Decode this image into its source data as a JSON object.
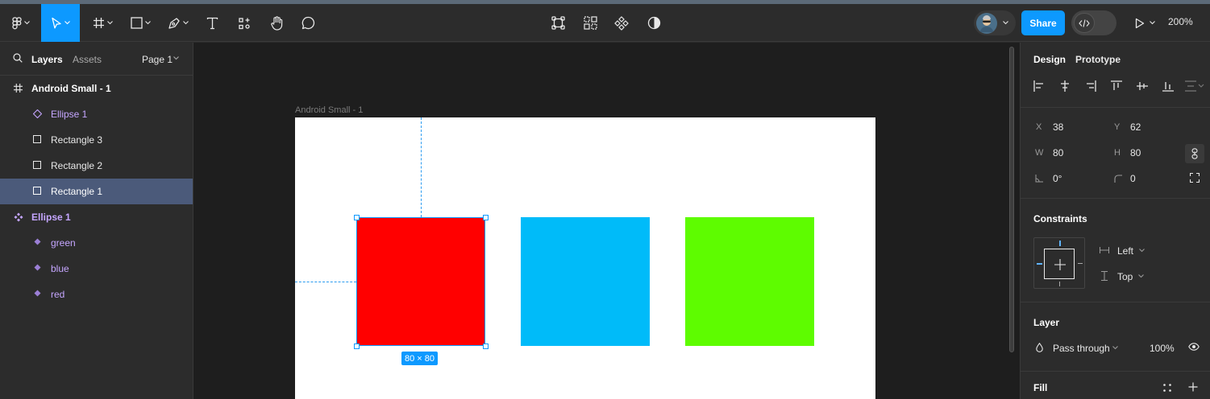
{
  "toolbar": {
    "tools": [
      "main-menu",
      "move",
      "frame",
      "shape",
      "pen",
      "text",
      "actions",
      "hand",
      "comment"
    ],
    "center_tools": [
      "crop",
      "grid",
      "component",
      "contrast"
    ],
    "share_label": "Share",
    "zoom_label": "200%"
  },
  "left_panel": {
    "tabs": {
      "layers": "Layers",
      "assets": "Assets"
    },
    "page": "Page 1",
    "layers": [
      {
        "label": "Android Small - 1",
        "icon": "frame-icon",
        "selected": false
      },
      {
        "label": "Ellipse 1",
        "icon": "component-instance-icon",
        "selected": false
      },
      {
        "label": "Rectangle 3",
        "icon": "rectangle-icon",
        "selected": false
      },
      {
        "label": "Rectangle 2",
        "icon": "rectangle-icon",
        "selected": false
      },
      {
        "label": "Rectangle 1",
        "icon": "rectangle-icon",
        "selected": true
      },
      {
        "label": "Ellipse 1",
        "icon": "component-set-icon",
        "selected": false
      },
      {
        "label": "green",
        "icon": "component-variant-icon",
        "selected": false
      },
      {
        "label": "blue",
        "icon": "component-variant-icon",
        "selected": false
      },
      {
        "label": "red",
        "icon": "component-variant-icon",
        "selected": false
      }
    ]
  },
  "canvas": {
    "frame_title": "Android Small - 1",
    "selection_size": "80 × 80",
    "rect_colors": {
      "red": "#ff0000",
      "blue": "#00bbf9",
      "green": "#5efc00"
    }
  },
  "right_panel": {
    "tabs": {
      "design": "Design",
      "prototype": "Prototype"
    },
    "position": {
      "x_label": "X",
      "x": "38",
      "y_label": "Y",
      "y": "62",
      "w_label": "W",
      "w": "80",
      "h_label": "H",
      "h": "80",
      "rotation": "0°",
      "radius": "0"
    },
    "constraints": {
      "title": "Constraints",
      "horizontal": "Left",
      "vertical": "Top"
    },
    "layer": {
      "title": "Layer",
      "blend": "Pass through",
      "opacity": "100%"
    },
    "fill": {
      "title": "Fill"
    }
  },
  "colors": {
    "accent": "#0d99ff",
    "selection_row": "#4b5a7a",
    "component_purple": "#c5a6ff"
  }
}
